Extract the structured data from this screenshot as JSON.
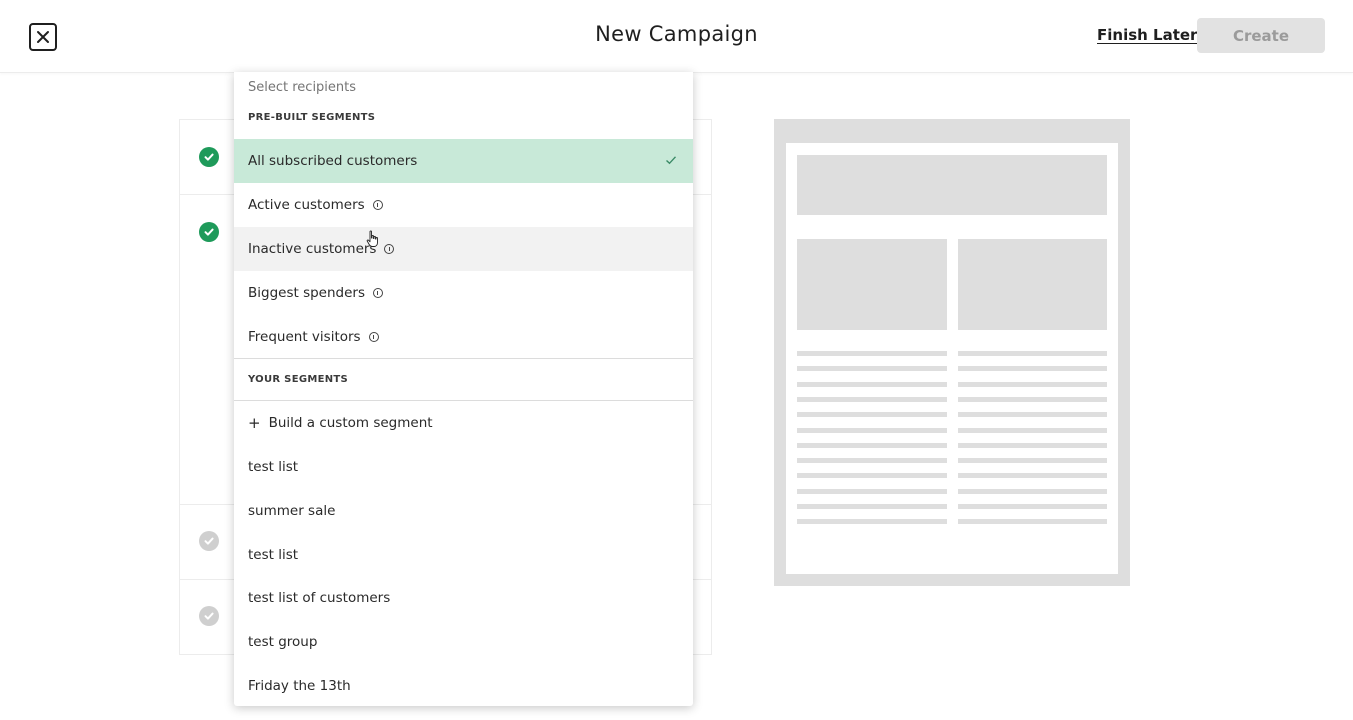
{
  "header": {
    "title": "New Campaign",
    "finish_later": "Finish Later",
    "create": "Create"
  },
  "dropdown": {
    "search_placeholder": "Select recipients",
    "prebuilt_heading": "PRE-BUILT SEGMENTS",
    "prebuilt": [
      {
        "label": "All subscribed customers",
        "selected": true
      },
      {
        "label": "Active customers",
        "info": true
      },
      {
        "label": "Inactive customers",
        "info": true
      },
      {
        "label": "Biggest spenders",
        "info": true
      },
      {
        "label": "Frequent visitors",
        "info": true
      }
    ],
    "your_heading": "YOUR SEGMENTS",
    "build_custom": "Build a custom segment",
    "yours": [
      {
        "label": "test list"
      },
      {
        "label": "summer sale"
      },
      {
        "label": "test list"
      },
      {
        "label": "test list of customers"
      },
      {
        "label": "test group"
      },
      {
        "label": "Friday the 13th"
      }
    ]
  },
  "steps": [
    {
      "status": "done"
    },
    {
      "status": "done"
    },
    {
      "status": "pending"
    },
    {
      "status": "pending"
    }
  ],
  "colors": {
    "selected_bg": "#c8e9d8",
    "done_check": "#1e9a5a",
    "pending_check": "#cfcfcf",
    "create_disabled": "#e2e2e2"
  },
  "icons": [
    "close-icon",
    "check-circle-icon",
    "checkmark-icon",
    "info-icon",
    "plus-icon",
    "hand-cursor-icon"
  ]
}
